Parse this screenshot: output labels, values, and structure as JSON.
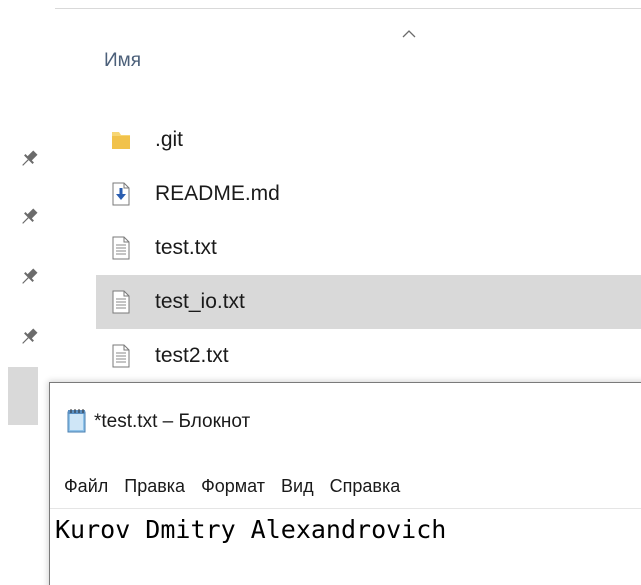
{
  "explorer": {
    "column_header": "Имя",
    "sort_indicator_icon": "chevron-up-icon",
    "pin_icon": "pin-icon",
    "files": [
      {
        "name": ".git",
        "icon": "folder-icon",
        "selected": false
      },
      {
        "name": "README.md",
        "icon": "download-file-icon",
        "selected": false
      },
      {
        "name": "test.txt",
        "icon": "text-file-icon",
        "selected": false
      },
      {
        "name": "test_io.txt",
        "icon": "text-file-icon",
        "selected": true
      },
      {
        "name": "test2.txt",
        "icon": "text-file-icon",
        "selected": false
      }
    ]
  },
  "notepad": {
    "title": "*test.txt – Блокнот",
    "icon": "notepad-icon",
    "menu": [
      "Файл",
      "Правка",
      "Формат",
      "Вид",
      "Справка"
    ],
    "content": "Kurov Dmitry Alexandrovich"
  },
  "colors": {
    "selection": "#d9d9d9",
    "header_text": "#4c607a",
    "folder": "#f7d674"
  }
}
